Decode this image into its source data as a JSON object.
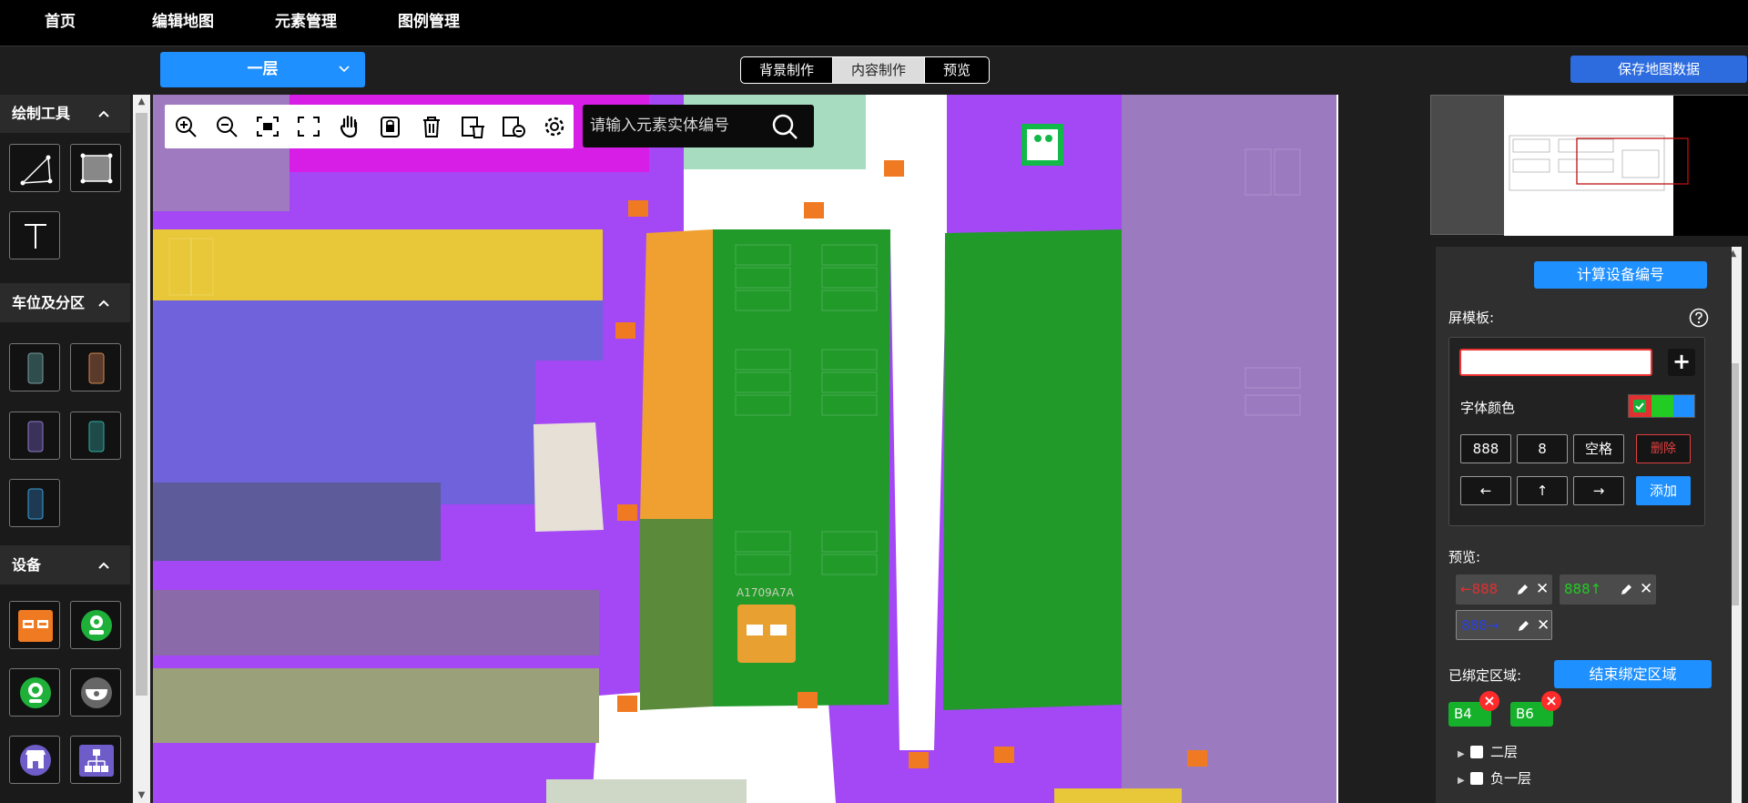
{
  "nav": {
    "items": [
      {
        "label": "首页"
      },
      {
        "label": "编辑地图"
      },
      {
        "label": "元素管理"
      },
      {
        "label": "图例管理"
      }
    ]
  },
  "toolbar": {
    "floor": "一层",
    "modes": [
      {
        "label": "背景制作",
        "active": false
      },
      {
        "label": "内容制作",
        "active": true
      },
      {
        "label": "预览",
        "active": false
      }
    ],
    "save_label": "保存地图数据"
  },
  "left_panel": {
    "sections": [
      {
        "title": "绘制工具",
        "tools": [
          "line-tool-icon",
          "rectangle-tool-icon",
          "text-tool-icon"
        ]
      },
      {
        "title": "车位及分区",
        "tools": [
          "parking-space-gray-icon",
          "parking-space-orange-icon",
          "parking-space-purple-icon",
          "parking-space-teal-icon",
          "parking-space-blue-icon"
        ]
      },
      {
        "title": "设备",
        "tools": [
          "guide-screen-icon",
          "camera-green-icon",
          "camera-dome-icon",
          "camera-hemisphere-icon",
          "store-icon",
          "network-icon"
        ]
      }
    ]
  },
  "map": {
    "search_placeholder": "请输入元素实体编号",
    "device_label": "A1709A7A",
    "tools": [
      "zoom-in-icon",
      "zoom-out-icon",
      "fit-screen-icon",
      "fullscreen-icon",
      "pan-hand-icon",
      "lock-icon",
      "delete-icon",
      "delete-layer-icon",
      "delete-selection-icon",
      "settings-icon"
    ]
  },
  "right_panel": {
    "calc_label": "计算设备编号",
    "template_label": "屏模板:",
    "template_value": "",
    "font_color_label": "字体颜色",
    "colors": [
      "#e03030",
      "#22cc22",
      "#1e90ff"
    ],
    "keys_row1": [
      "888",
      "8",
      "空格",
      "删除"
    ],
    "keys_row2": [
      "←",
      "↑",
      "→",
      "添加"
    ],
    "preview_label": "预览:",
    "previews": [
      {
        "text": "←888",
        "color": "#e03030"
      },
      {
        "text": "888↑",
        "color": "#22cc22"
      },
      {
        "text": "888→",
        "color": "#2c3fe0"
      }
    ],
    "bound_label": "已绑定区域:",
    "end_bind_label": "结束绑定区域",
    "zones": [
      "B4",
      "B6"
    ],
    "tree": [
      "二层",
      "负一层"
    ]
  }
}
